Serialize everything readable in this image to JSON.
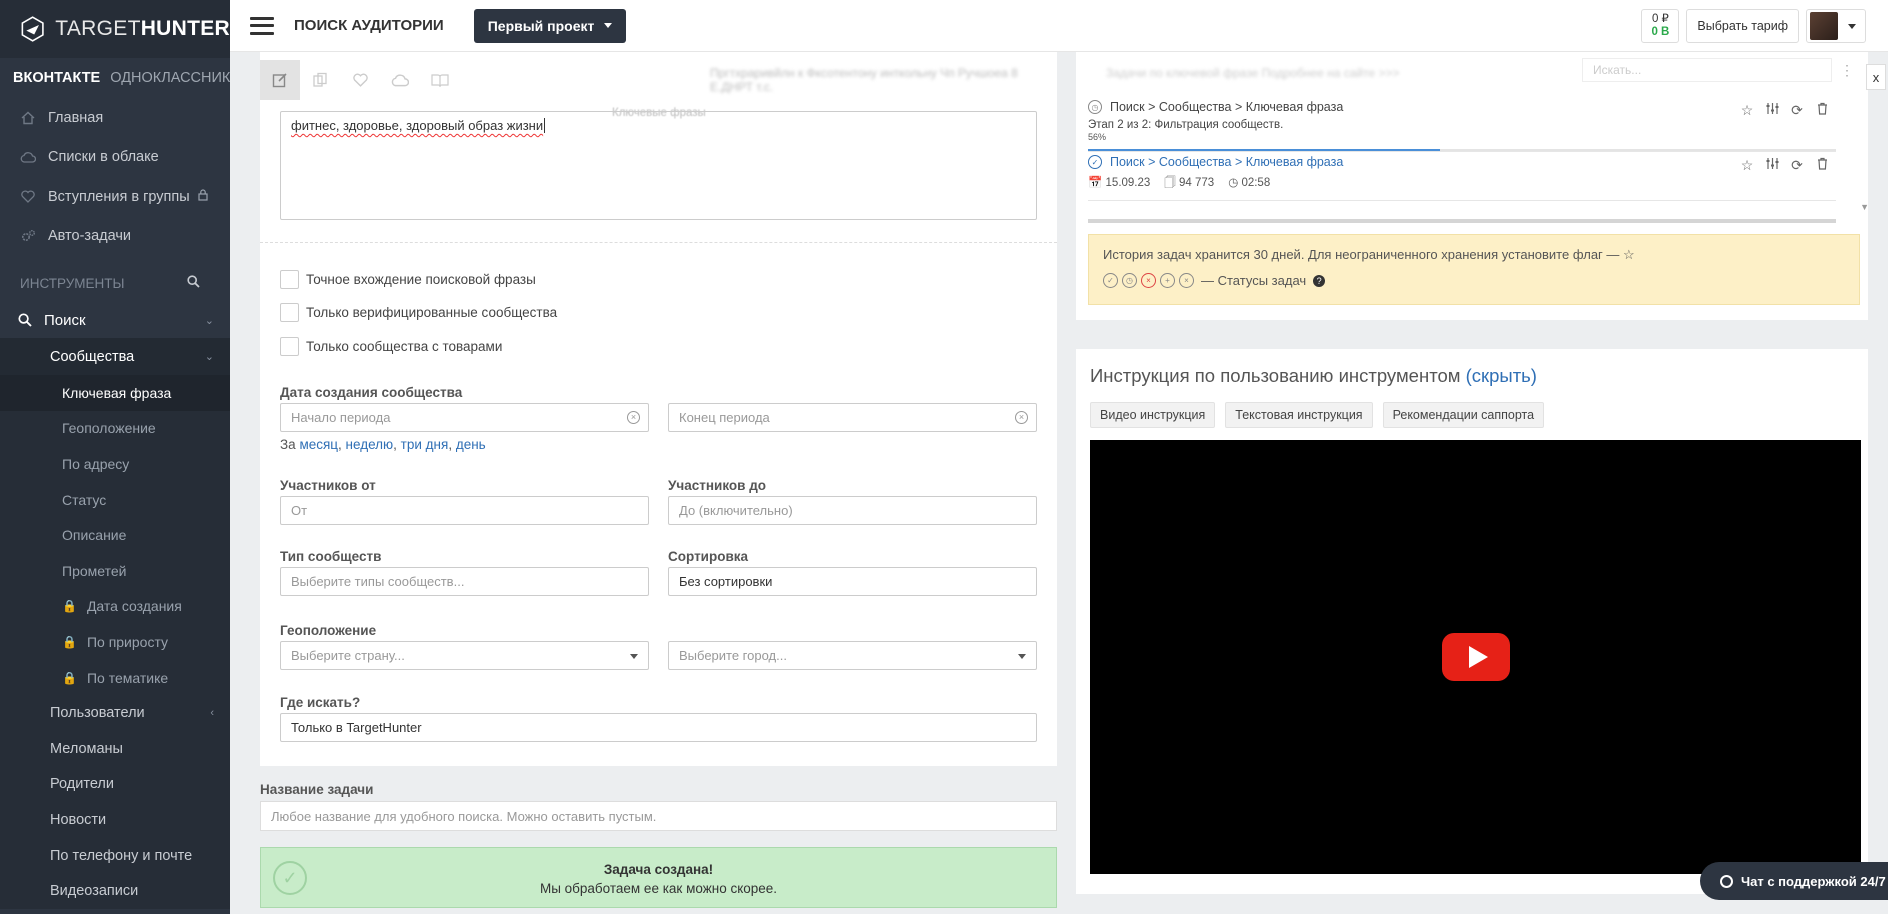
{
  "brand": {
    "light": "TARGET",
    "bold": "HUNTER"
  },
  "networks": {
    "active": "ВКОНТАКТЕ",
    "inactive": "ОДНОКЛАССНИКИ"
  },
  "sidebar": {
    "main_items": [
      {
        "label": "Главная",
        "icon": "home-icon"
      },
      {
        "label": "Списки в облаке",
        "icon": "cloud-icon"
      },
      {
        "label": "Вступления в группы",
        "icon": "heart-icon",
        "locked": true
      },
      {
        "label": "Авто-задачи",
        "icon": "gears-icon"
      }
    ],
    "tools_title": "ИНСТРУМЕНТЫ",
    "search_label": "Поиск",
    "communities_label": "Сообщества",
    "community_items": [
      {
        "label": "Ключевая фраза",
        "active": true
      },
      {
        "label": "Геоположение"
      },
      {
        "label": "По адресу"
      },
      {
        "label": "Статус"
      },
      {
        "label": "Описание"
      },
      {
        "label": "Прометей"
      },
      {
        "label": "Дата создания",
        "locked": true
      },
      {
        "label": "По приросту",
        "locked": true
      },
      {
        "label": "По тематике",
        "locked": true
      }
    ],
    "users_label": "Пользователи",
    "other_items": [
      "Меломаны",
      "Родители",
      "Новости",
      "По телефону и почте",
      "Видеозаписи"
    ]
  },
  "topbar": {
    "title": "ПОИСК АУДИТОРИИ",
    "project": "Первый проект",
    "balance_rub": "0 ₽",
    "balance_b": "0 B",
    "tariff": "Выбрать тариф"
  },
  "form": {
    "blur_top": "Пргтхраривйлн к Фксотентону инткольну Чп Ручшоеа 8 Е.ДНРТ т.с.",
    "keywords_label": "Ключевые фразы",
    "keywords_value": "фитнес, здоровье, здоровый образ жизни",
    "checkboxes": [
      "Точное вхождение поисковой фразы",
      "Только верифицированные сообщества",
      "Только сообщества с товарами"
    ],
    "date_label": "Дата создания сообщества",
    "date_start_placeholder": "Начало периода",
    "date_end_placeholder": "Конец периода",
    "period_prefix": "За",
    "period_links": [
      "месяц",
      "неделю",
      "три дня",
      "день"
    ],
    "members_from_label": "Участников от",
    "members_from_placeholder": "От",
    "members_to_label": "Участников до",
    "members_to_placeholder": "До (включительно)",
    "type_label": "Тип сообществ",
    "type_placeholder": "Выберите типы сообществ...",
    "sort_label": "Сортировка",
    "sort_value": "Без сортировки",
    "geo_label": "Геоположение",
    "country_placeholder": "Выберите страну...",
    "city_placeholder": "Выберите город...",
    "where_label": "Где искать?",
    "where_value": "Только в TargetHunter"
  },
  "task": {
    "name_label": "Название задачи",
    "name_placeholder": "Любое название для удобного поиска. Можно оставить пустым.",
    "success_title": "Задача создана!",
    "success_text": "Мы обработаем ее как можно скорее."
  },
  "tasks_panel": {
    "blur_header": "Задачи по ключевой фразе  Подробнее на сайте >>>",
    "search_placeholder": "Искать...",
    "rows": [
      {
        "path": "Поиск > Сообщества > Ключевая фраза",
        "stage": "Этап 2 из 2: Фильтрация сообществ.",
        "percent": "56%",
        "progress": 0.47
      },
      {
        "path": "Поиск > Сообщества > Ключевая фраза",
        "date": "15.09.23",
        "count": "94 773",
        "time": "02:58"
      }
    ],
    "history_text": "История задач хранится 30 дней. Для неограниченного хранения установите флаг —",
    "statuses_label": "— Статусы задач"
  },
  "instructions": {
    "title": "Инструкция по пользованию инструментом",
    "hide_link": "(скрыть)",
    "tabs": [
      "Видео инструкция",
      "Текстовая инструкция",
      "Рекомендации саппорта"
    ]
  },
  "close_label": "x",
  "chat": {
    "label": "Чат с поддержкой 24/7"
  },
  "colors": {
    "sidebar": "#2d3541",
    "accent": "#2f6fb5",
    "success": "#c8ecc9",
    "warning": "#fdf0c7",
    "youtube": "#e62117"
  }
}
